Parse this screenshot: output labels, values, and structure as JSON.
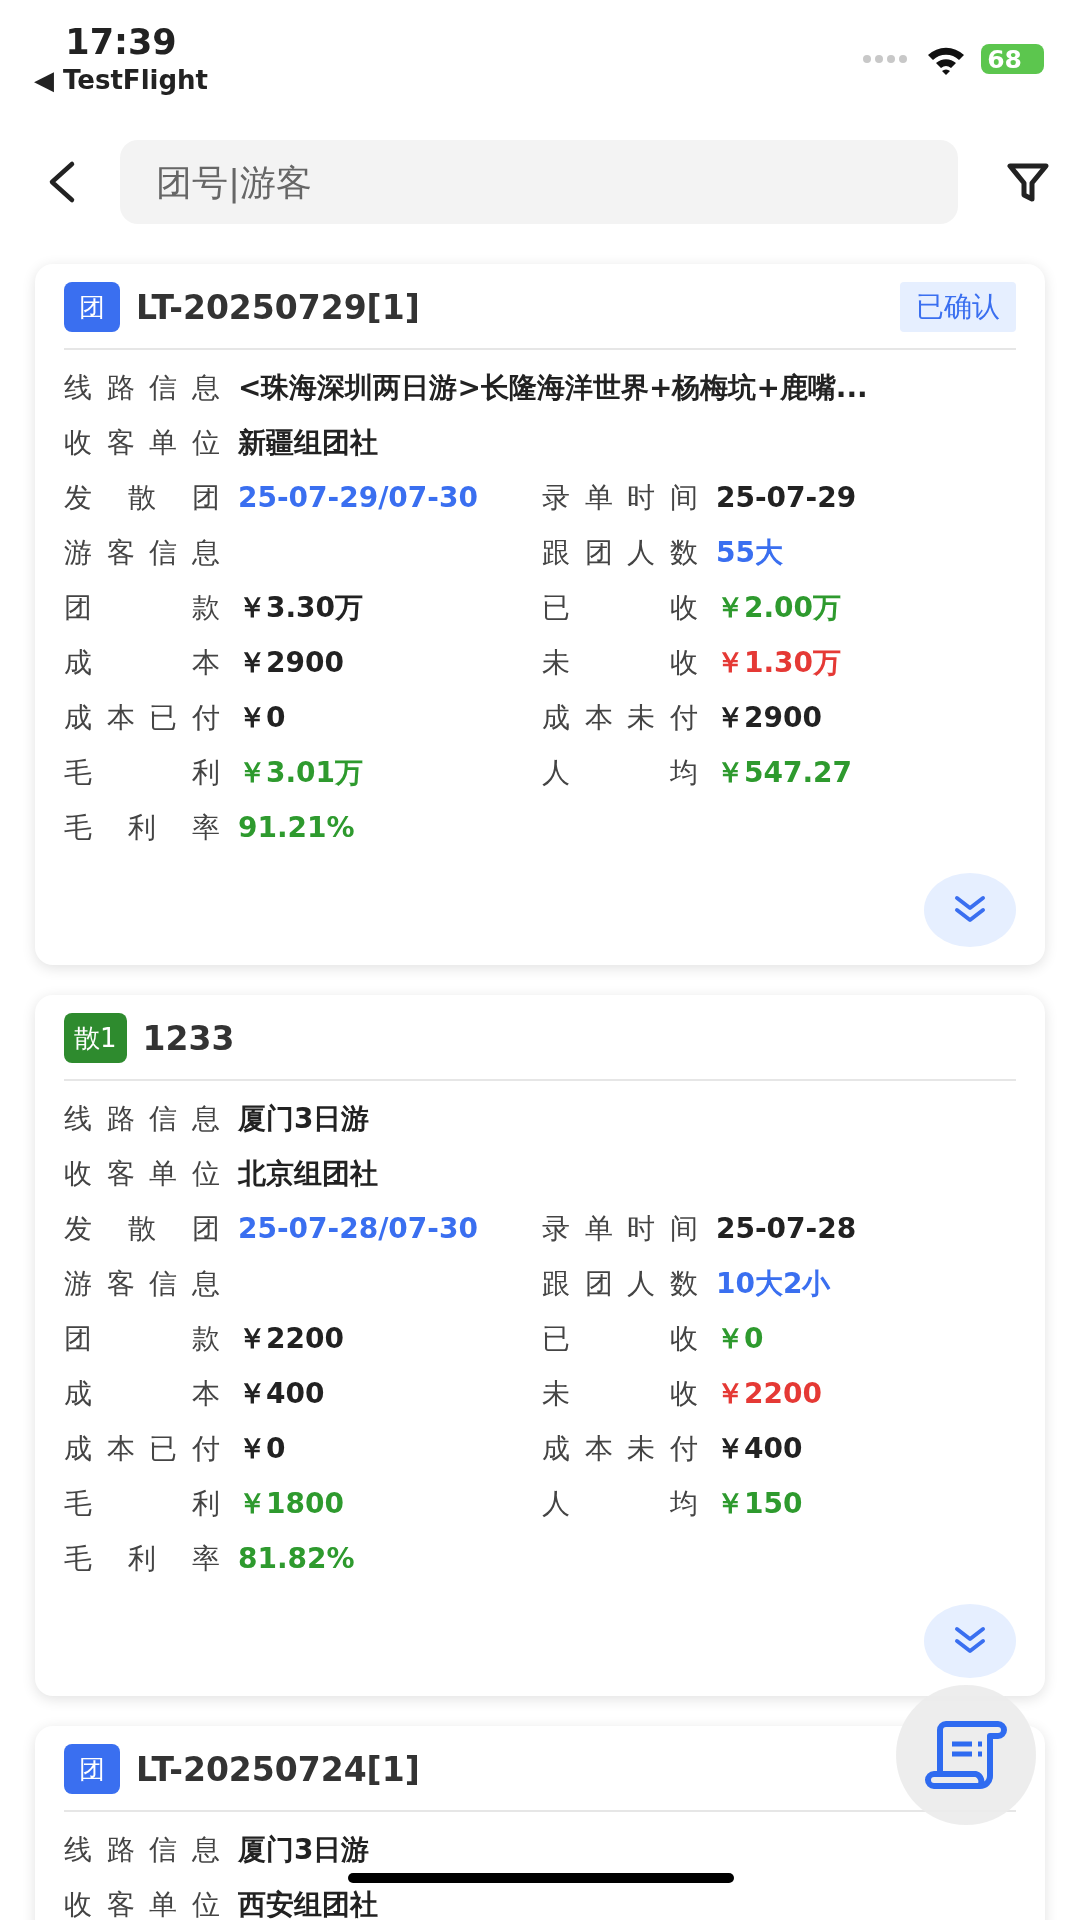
{
  "status_bar": {
    "time": "17:39",
    "back_app": "◀ TestFlight",
    "battery": "68"
  },
  "header": {
    "search": {
      "placeholder": "团号|游客"
    }
  },
  "cards": [
    {
      "tag": {
        "label": "团",
        "color": "#3a6ff0"
      },
      "title": "LT-20250729[1]",
      "status": "已确认",
      "fields": [
        {
          "kind": "wide",
          "label": "线路信息",
          "value": "<珠海深圳两日游>长隆海洋世界+杨梅坑+鹿嘴...",
          "color": "#222222"
        },
        {
          "kind": "wide",
          "label": "收客单位",
          "value": "新疆组团社",
          "color": "#222222"
        },
        {
          "kind": "half",
          "label": "发散团",
          "value": "25-07-29/07-30",
          "color": "#3a6ff0"
        },
        {
          "kind": "half",
          "label": "录单时间",
          "value": "25-07-29",
          "color": "#222222"
        },
        {
          "kind": "half",
          "label": "游客信息"
        },
        {
          "kind": "half",
          "label": "跟团人数",
          "value": "55大",
          "color": "#3a6ff0"
        },
        {
          "kind": "half",
          "label": "团款",
          "value": "￥3.30万",
          "color": "#222222"
        },
        {
          "kind": "half",
          "label": "已收",
          "value": "￥2.00万",
          "color": "#2e9a2e"
        },
        {
          "kind": "half",
          "label": "成本",
          "value": "￥2900",
          "color": "#222222"
        },
        {
          "kind": "half",
          "label": "未收",
          "value": "￥1.30万",
          "color": "#e53935"
        },
        {
          "kind": "half",
          "label": "成本已付",
          "value": "￥0",
          "color": "#222222"
        },
        {
          "kind": "half",
          "label": "成本未付",
          "value": "￥2900",
          "color": "#222222"
        },
        {
          "kind": "half",
          "label": "毛利",
          "value": "￥3.01万",
          "color": "#2e9a2e"
        },
        {
          "kind": "half",
          "label": "人均",
          "value": "￥547.27",
          "color": "#2e9a2e"
        },
        {
          "kind": "half",
          "label": "毛利率",
          "value": "91.21%",
          "color": "#2e9a2e"
        }
      ]
    },
    {
      "tag": {
        "label": "散1",
        "color": "#2e8b2e"
      },
      "title": "1233",
      "fields": [
        {
          "kind": "wide",
          "label": "线路信息",
          "value": "厦门3日游",
          "color": "#222222"
        },
        {
          "kind": "wide",
          "label": "收客单位",
          "value": "北京组团社",
          "color": "#222222"
        },
        {
          "kind": "half",
          "label": "发散团",
          "value": "25-07-28/07-30",
          "color": "#3a6ff0"
        },
        {
          "kind": "half",
          "label": "录单时间",
          "value": "25-07-28",
          "color": "#222222"
        },
        {
          "kind": "half",
          "label": "游客信息"
        },
        {
          "kind": "half",
          "label": "跟团人数",
          "value": "10大2小",
          "color": "#3a6ff0"
        },
        {
          "kind": "half",
          "label": "团款",
          "value": "￥2200",
          "color": "#222222"
        },
        {
          "kind": "half",
          "label": "已收",
          "value": "￥0",
          "color": "#2e9a2e"
        },
        {
          "kind": "half",
          "label": "成本",
          "value": "￥400",
          "color": "#222222"
        },
        {
          "kind": "half",
          "label": "未收",
          "value": "￥2200",
          "color": "#e53935"
        },
        {
          "kind": "half",
          "label": "成本已付",
          "value": "￥0",
          "color": "#222222"
        },
        {
          "kind": "half",
          "label": "成本未付",
          "value": "￥400",
          "color": "#222222"
        },
        {
          "kind": "half",
          "label": "毛利",
          "value": "￥1800",
          "color": "#2e9a2e"
        },
        {
          "kind": "half",
          "label": "人均",
          "value": "￥150",
          "color": "#2e9a2e"
        },
        {
          "kind": "half",
          "label": "毛利率",
          "value": "81.82%",
          "color": "#2e9a2e"
        }
      ]
    },
    {
      "tag": {
        "label": "团",
        "color": "#3a6ff0"
      },
      "title": "LT-20250724[1]",
      "fields": [
        {
          "kind": "wide",
          "label": "线路信息",
          "value": "厦门3日游",
          "color": "#222222"
        },
        {
          "kind": "wide",
          "label": "收客单位",
          "value": "西安组团社",
          "color": "#222222"
        }
      ]
    }
  ]
}
